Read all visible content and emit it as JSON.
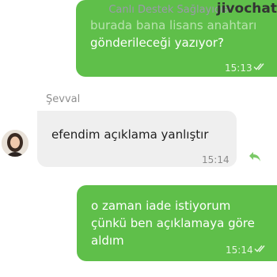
{
  "header": {
    "agent_label": "Canlı Destek Sağlayıcısı",
    "brand": "jivochat"
  },
  "messages": [
    {
      "direction": "outgoing",
      "lines": [
        "burada bana lisans anahtarı",
        "gönderileceği yazıyor?"
      ],
      "time": "15:13",
      "status_icon": "double-check-icon"
    },
    {
      "direction": "incoming",
      "sender": "Şevval",
      "lines": [
        "efendim açıklama yanlıştır"
      ],
      "time": "15:14",
      "action_icon": "reply-icon"
    },
    {
      "direction": "outgoing",
      "lines": [
        "o zaman iade istiyorum",
        "çünkü ben açıklamaya göre",
        "aldım"
      ],
      "time": "15:14",
      "status_icon": "double-check-icon"
    }
  ]
}
